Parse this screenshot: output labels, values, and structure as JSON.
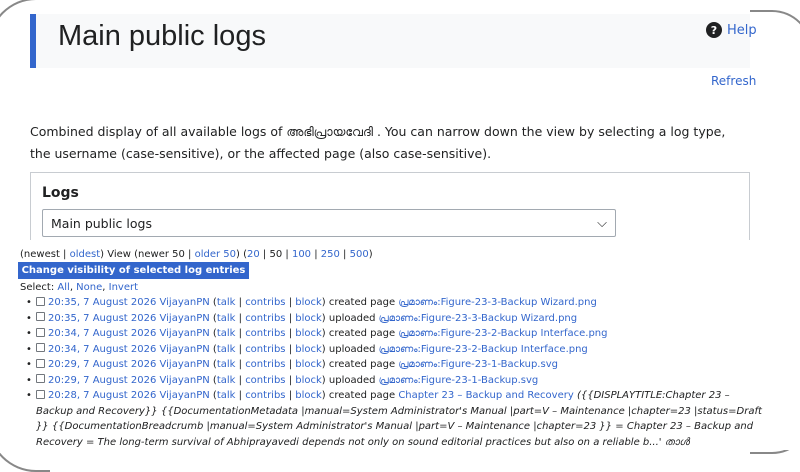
{
  "header": {
    "title": "Main public logs",
    "help_label": "Help",
    "refresh_label": "Refresh"
  },
  "intro": {
    "before": "Combined display of all available logs of ",
    "site": "അഭിപ്രായവേദി",
    "after": " . You can narrow down the view by selecting a log type, the username (case-sensitive), or the affected page (also case-sensitive)."
  },
  "logs": {
    "label": "Logs",
    "selected": "Main public logs"
  },
  "nav": {
    "newest": "newest",
    "oldest": "oldest",
    "view_text": "View (newer 50 |",
    "older": "older 50",
    "limits": [
      "20",
      "50",
      "100",
      "250",
      "500"
    ]
  },
  "visibility_button": "Change visibility of selected log entries",
  "select": {
    "label": "Select:",
    "all": "All",
    "none": "None",
    "invert": "Invert"
  },
  "entry_labels": {
    "talk": "talk",
    "contribs": "contribs",
    "block": "block"
  },
  "entries": [
    {
      "time": "20:35, 7 August 2026",
      "user": "VijayanPN",
      "action": "created page",
      "page": "പ്രമാണം:Figure-23-3-Backup Wizard.png"
    },
    {
      "time": "20:35, 7 August 2026",
      "user": "VijayanPN",
      "action": "uploaded",
      "page": "പ്രമാണം:Figure-23-3-Backup Wizard.png"
    },
    {
      "time": "20:34, 7 August 2026",
      "user": "VijayanPN",
      "action": "created page",
      "page": "പ്രമാണം:Figure-23-2-Backup Interface.png"
    },
    {
      "time": "20:34, 7 August 2026",
      "user": "VijayanPN",
      "action": "uploaded",
      "page": "പ്രമാണം:Figure-23-2-Backup Interface.png"
    },
    {
      "time": "20:29, 7 August 2026",
      "user": "VijayanPN",
      "action": "created page",
      "page": "പ്രമാണം:Figure-23-1-Backup.svg"
    },
    {
      "time": "20:29, 7 August 2026",
      "user": "VijayanPN",
      "action": "uploaded",
      "page": "പ്രമാണം:Figure-23-1-Backup.svg"
    }
  ],
  "last_entry": {
    "time": "20:28, 7 August 2026",
    "user": "VijayanPN",
    "action": "created page",
    "page": "Chapter 23 – Backup and Recovery",
    "summary": "({{DISPLAYTITLE:Chapter 23 – Backup and Recovery}} {{DocumentationMetadata |manual=System Administrator's Manual |part=V – Maintenance |chapter=23 |status=Draft }} {{DocumentationBreadcrumb |manual=System Administrator's Manual |part=V – Maintenance |chapter=23 }} = Chapter 23 – Backup and Recovery = The long-term survival of Abhiprayavedi depends not only on sound editorial practices but also on a reliable b...' താൾ"
  },
  "colors": {
    "link": "#3366cc",
    "button": "#3366cc",
    "accent_bar": "#3366cc"
  }
}
